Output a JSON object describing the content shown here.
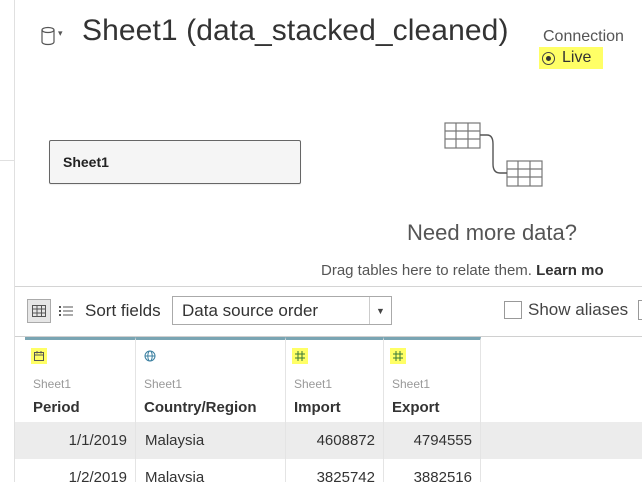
{
  "header": {
    "title": "Sheet1 (data_stacked_cleaned)",
    "connection_label": "Connection",
    "connection_mode": "Live"
  },
  "canvas": {
    "table_name": "Sheet1",
    "need_more_title": "Need more data?",
    "drag_hint": "Drag tables here to relate them.",
    "learn_more": "Learn mo"
  },
  "toolbar": {
    "sort_label": "Sort fields",
    "sort_value": "Data source order",
    "show_aliases_label": "Show aliases"
  },
  "grid": {
    "columns": [
      {
        "source": "Sheet1",
        "name": "Period",
        "type_icon": "calendar-icon"
      },
      {
        "source": "Sheet1",
        "name": "Country/Region",
        "type_icon": "globe-icon"
      },
      {
        "source": "Sheet1",
        "name": "Import",
        "type_icon": "number-icon"
      },
      {
        "source": "Sheet1",
        "name": "Export",
        "type_icon": "number-icon"
      }
    ],
    "rows": [
      [
        "1/1/2019",
        "Malaysia",
        "4608872",
        "4794555"
      ],
      [
        "1/2/2019",
        "Malaysia",
        "3825742",
        "3882516"
      ]
    ]
  },
  "colors": {
    "highlight": "#ffff66",
    "column_accent": "#7aa5b3"
  }
}
